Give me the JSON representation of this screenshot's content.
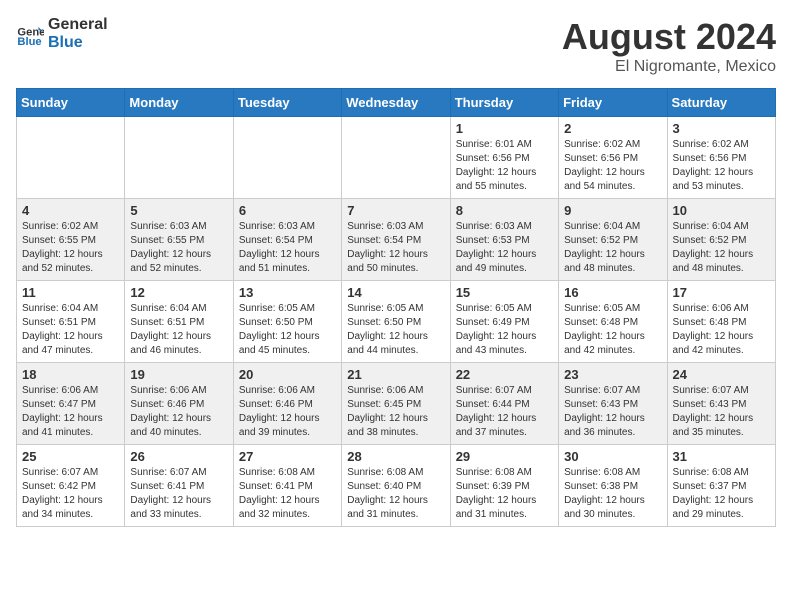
{
  "header": {
    "logo_general": "General",
    "logo_blue": "Blue",
    "title": "August 2024",
    "location": "El Nigromante, Mexico"
  },
  "weekdays": [
    "Sunday",
    "Monday",
    "Tuesday",
    "Wednesday",
    "Thursday",
    "Friday",
    "Saturday"
  ],
  "weeks": [
    [
      {
        "day": "",
        "info": ""
      },
      {
        "day": "",
        "info": ""
      },
      {
        "day": "",
        "info": ""
      },
      {
        "day": "",
        "info": ""
      },
      {
        "day": "1",
        "info": "Sunrise: 6:01 AM\nSunset: 6:56 PM\nDaylight: 12 hours and 55 minutes."
      },
      {
        "day": "2",
        "info": "Sunrise: 6:02 AM\nSunset: 6:56 PM\nDaylight: 12 hours and 54 minutes."
      },
      {
        "day": "3",
        "info": "Sunrise: 6:02 AM\nSunset: 6:56 PM\nDaylight: 12 hours and 53 minutes."
      }
    ],
    [
      {
        "day": "4",
        "info": "Sunrise: 6:02 AM\nSunset: 6:55 PM\nDaylight: 12 hours and 52 minutes."
      },
      {
        "day": "5",
        "info": "Sunrise: 6:03 AM\nSunset: 6:55 PM\nDaylight: 12 hours and 52 minutes."
      },
      {
        "day": "6",
        "info": "Sunrise: 6:03 AM\nSunset: 6:54 PM\nDaylight: 12 hours and 51 minutes."
      },
      {
        "day": "7",
        "info": "Sunrise: 6:03 AM\nSunset: 6:54 PM\nDaylight: 12 hours and 50 minutes."
      },
      {
        "day": "8",
        "info": "Sunrise: 6:03 AM\nSunset: 6:53 PM\nDaylight: 12 hours and 49 minutes."
      },
      {
        "day": "9",
        "info": "Sunrise: 6:04 AM\nSunset: 6:52 PM\nDaylight: 12 hours and 48 minutes."
      },
      {
        "day": "10",
        "info": "Sunrise: 6:04 AM\nSunset: 6:52 PM\nDaylight: 12 hours and 48 minutes."
      }
    ],
    [
      {
        "day": "11",
        "info": "Sunrise: 6:04 AM\nSunset: 6:51 PM\nDaylight: 12 hours and 47 minutes."
      },
      {
        "day": "12",
        "info": "Sunrise: 6:04 AM\nSunset: 6:51 PM\nDaylight: 12 hours and 46 minutes."
      },
      {
        "day": "13",
        "info": "Sunrise: 6:05 AM\nSunset: 6:50 PM\nDaylight: 12 hours and 45 minutes."
      },
      {
        "day": "14",
        "info": "Sunrise: 6:05 AM\nSunset: 6:50 PM\nDaylight: 12 hours and 44 minutes."
      },
      {
        "day": "15",
        "info": "Sunrise: 6:05 AM\nSunset: 6:49 PM\nDaylight: 12 hours and 43 minutes."
      },
      {
        "day": "16",
        "info": "Sunrise: 6:05 AM\nSunset: 6:48 PM\nDaylight: 12 hours and 42 minutes."
      },
      {
        "day": "17",
        "info": "Sunrise: 6:06 AM\nSunset: 6:48 PM\nDaylight: 12 hours and 42 minutes."
      }
    ],
    [
      {
        "day": "18",
        "info": "Sunrise: 6:06 AM\nSunset: 6:47 PM\nDaylight: 12 hours and 41 minutes."
      },
      {
        "day": "19",
        "info": "Sunrise: 6:06 AM\nSunset: 6:46 PM\nDaylight: 12 hours and 40 minutes."
      },
      {
        "day": "20",
        "info": "Sunrise: 6:06 AM\nSunset: 6:46 PM\nDaylight: 12 hours and 39 minutes."
      },
      {
        "day": "21",
        "info": "Sunrise: 6:06 AM\nSunset: 6:45 PM\nDaylight: 12 hours and 38 minutes."
      },
      {
        "day": "22",
        "info": "Sunrise: 6:07 AM\nSunset: 6:44 PM\nDaylight: 12 hours and 37 minutes."
      },
      {
        "day": "23",
        "info": "Sunrise: 6:07 AM\nSunset: 6:43 PM\nDaylight: 12 hours and 36 minutes."
      },
      {
        "day": "24",
        "info": "Sunrise: 6:07 AM\nSunset: 6:43 PM\nDaylight: 12 hours and 35 minutes."
      }
    ],
    [
      {
        "day": "25",
        "info": "Sunrise: 6:07 AM\nSunset: 6:42 PM\nDaylight: 12 hours and 34 minutes."
      },
      {
        "day": "26",
        "info": "Sunrise: 6:07 AM\nSunset: 6:41 PM\nDaylight: 12 hours and 33 minutes."
      },
      {
        "day": "27",
        "info": "Sunrise: 6:08 AM\nSunset: 6:41 PM\nDaylight: 12 hours and 32 minutes."
      },
      {
        "day": "28",
        "info": "Sunrise: 6:08 AM\nSunset: 6:40 PM\nDaylight: 12 hours and 31 minutes."
      },
      {
        "day": "29",
        "info": "Sunrise: 6:08 AM\nSunset: 6:39 PM\nDaylight: 12 hours and 31 minutes."
      },
      {
        "day": "30",
        "info": "Sunrise: 6:08 AM\nSunset: 6:38 PM\nDaylight: 12 hours and 30 minutes."
      },
      {
        "day": "31",
        "info": "Sunrise: 6:08 AM\nSunset: 6:37 PM\nDaylight: 12 hours and 29 minutes."
      }
    ]
  ]
}
